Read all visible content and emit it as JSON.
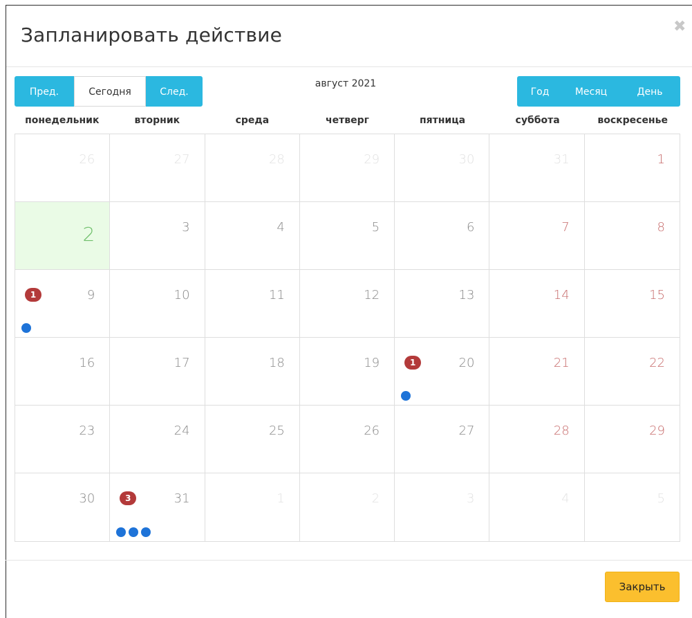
{
  "modal": {
    "title": "Запланировать действие",
    "close_icon": "close-icon"
  },
  "nav": {
    "prev": "Пред.",
    "today": "Сегодня",
    "next": "След."
  },
  "view": {
    "year": "Год",
    "month": "Месяц",
    "day": "День"
  },
  "calendar": {
    "month_title": "август 2021",
    "weekdays": [
      "понедельник",
      "вторник",
      "среда",
      "четверг",
      "пятница",
      "суббота",
      "воскресенье"
    ],
    "weeks": [
      [
        "26",
        "27",
        "28",
        "29",
        "30",
        "31",
        "1"
      ],
      [
        "2",
        "3",
        "4",
        "5",
        "6",
        "7",
        "8"
      ],
      [
        "9",
        "10",
        "11",
        "12",
        "13",
        "14",
        "15"
      ],
      [
        "16",
        "17",
        "18",
        "19",
        "20",
        "21",
        "22"
      ],
      [
        "23",
        "24",
        "25",
        "26",
        "27",
        "28",
        "29"
      ],
      [
        "30",
        "31",
        "1",
        "2",
        "3",
        "4",
        "5"
      ]
    ],
    "event_badges": {
      "aug9": "1",
      "aug20": "1",
      "aug31": "3"
    },
    "colors": {
      "today_bg": "#eafbe6",
      "today_num": "#6fbf6b",
      "weekend_num": "#c76b6b",
      "badge": "#b33a3a",
      "event_dot": "#1e73d8",
      "accent_button": "#2bb8e0",
      "close_button": "#fbbf2e"
    }
  },
  "footer": {
    "close": "Закрыть"
  }
}
